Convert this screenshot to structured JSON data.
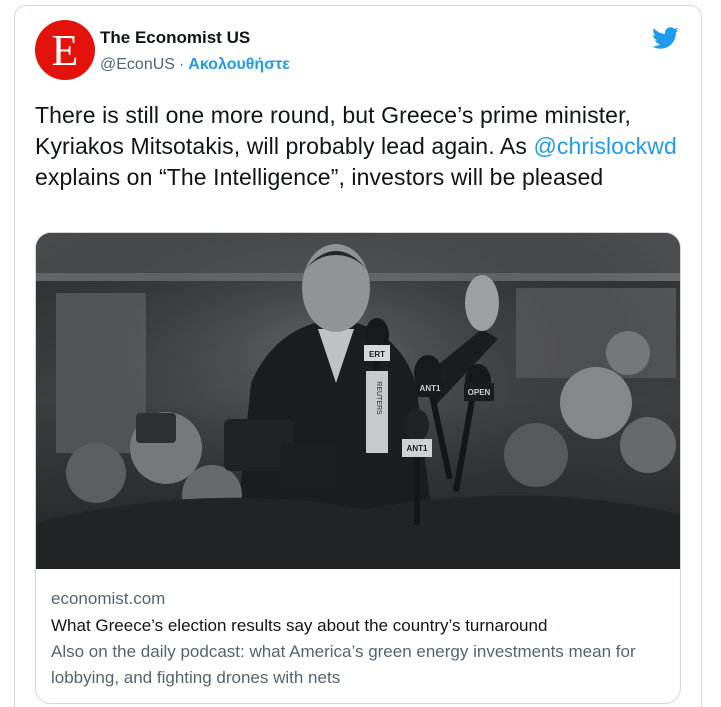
{
  "tweet": {
    "author": {
      "avatar_letter": "E",
      "avatar_color": "#e3120b",
      "name": "The Economist US",
      "handle": "@EconUS",
      "separator": "·",
      "follow_label": "Ακολουθήστε"
    },
    "platform_icon": "twitter-bird-icon",
    "text": {
      "part1": "There is still one more round, but Greece’s prime minister, Kyriakos Mitsotakis, will probably lead again. As ",
      "mention": "@chrislockwd",
      "part2": " explains on “The Intelligence”, investors will be pleased"
    },
    "link_card": {
      "image": "Black-and-white photo of Kyriakos Mitsotakis waving amid a crowd of reporters holding microphones",
      "mic_labels": [
        "ERT",
        "REUTERS",
        "ANT1",
        "OPEN",
        "ANT1"
      ],
      "domain": "economist.com",
      "title": "What Greece’s election results say about the country’s turnaround",
      "description": "Also on the daily podcast: what America’s green energy investments mean for lobbying, and fighting drones with nets"
    }
  },
  "colors": {
    "accent": "#1d9bf0",
    "text_primary": "#0f1419",
    "text_secondary": "#536471",
    "border": "#cfd9de",
    "brand_red": "#e3120b"
  }
}
